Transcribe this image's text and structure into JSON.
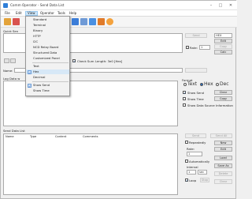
{
  "window": {
    "title": "Comm Operator - Send Data List",
    "minimize": "–",
    "maximize": "□",
    "close": "✕"
  },
  "menubar": {
    "items": [
      {
        "label": "File"
      },
      {
        "label": "Edit"
      },
      {
        "label": "View"
      },
      {
        "label": "Operator"
      },
      {
        "label": "Tools"
      },
      {
        "label": "Help"
      }
    ]
  },
  "view_menu": {
    "items": [
      {
        "label": "Standard",
        "checked": false
      },
      {
        "label": "Terminal",
        "checked": false
      },
      {
        "label": "Binary",
        "checked": false
      },
      {
        "label": "HTTP",
        "checked": false
      },
      {
        "label": "I2C",
        "checked": false
      },
      {
        "label": "NCD Relay Board",
        "checked": false
      },
      {
        "label": "Structured Data",
        "checked": false
      },
      {
        "label": "Customized Panel",
        "checked": false
      },
      {
        "label": "Text",
        "checked": false
      },
      {
        "label": "Hex",
        "checked": true
      },
      {
        "label": "Decimal",
        "checked": false
      },
      {
        "label": "Show Send",
        "checked": true
      },
      {
        "label": "Show Time",
        "checked": false
      }
    ]
  },
  "quick_send": {
    "label": "Quick Sen",
    "buttons": {
      "send": "Send",
      "edit": "Edit",
      "copy": "Copy"
    },
    "format_select": "HEX",
    "rate_label": "Rate:",
    "rate_value": "1",
    "calc_button": "Calc",
    "check_sum_label": "Check Sum",
    "length_label": "Length: 3e0 [Hex]",
    "name_label": "Name:"
  },
  "log": {
    "label": "Log  Data w",
    "format_group": "Format",
    "text_option": "Text",
    "hex_option": "Hex",
    "dec_option": "Dec",
    "show_send": "Show Send",
    "show_time": "Show Time",
    "show_source": "Show Data Source Information",
    "clear_button": "Clear",
    "copy_button": "Copy",
    "save_button": "Save"
  },
  "send_list": {
    "label": "Send Data List",
    "columns": [
      "Name",
      "Type",
      "Content",
      "Comments"
    ],
    "buttons": [
      "Send",
      "Send All",
      "New",
      "Edit",
      "Load",
      "Save As",
      "Delete",
      "Clear"
    ],
    "repeatedly_send": "Repeatedly",
    "rate_label": "Rate:",
    "rate_value": "1",
    "automatically": "Automatically",
    "interval_label": "Interval",
    "interval_value": "1",
    "interval_unit": "sec",
    "loop_label": "Loop",
    "stop_button": "Stop"
  },
  "colors": {
    "accent": "#1f6fd1",
    "dropdown_highlight": "#d7e8f7"
  }
}
